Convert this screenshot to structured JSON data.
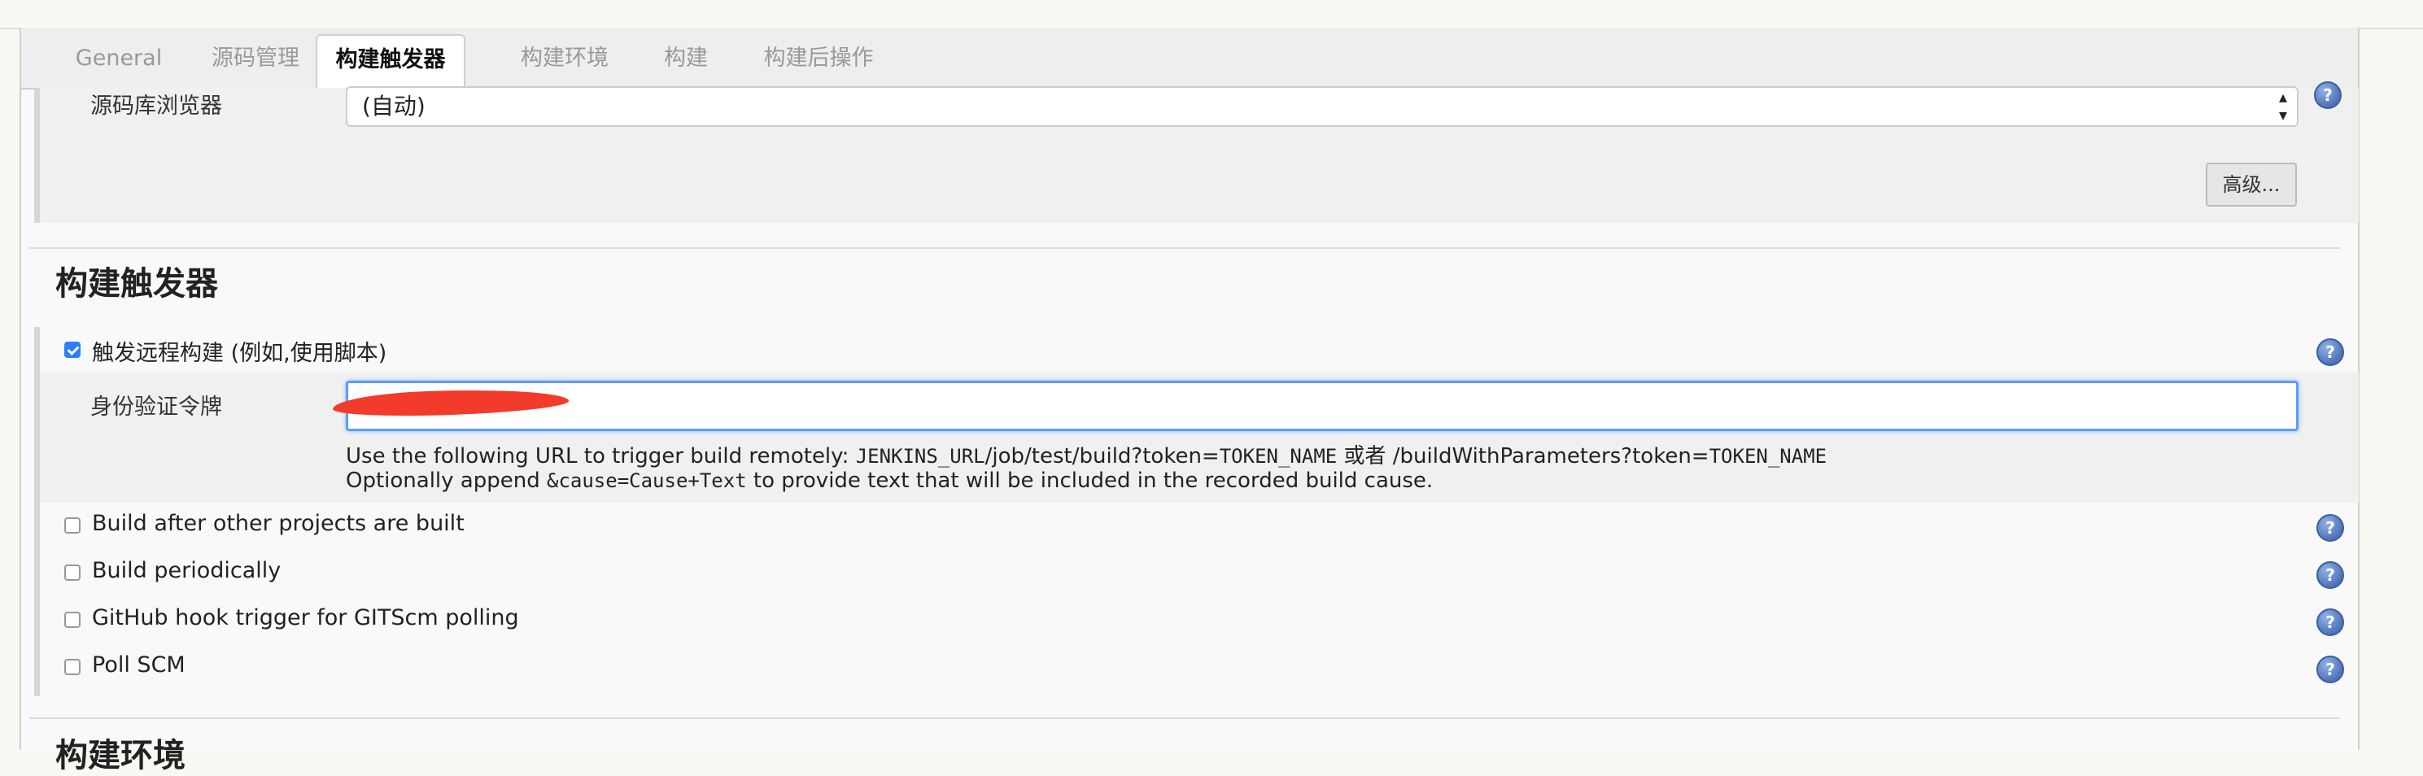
{
  "tabs": [
    {
      "label": "General"
    },
    {
      "label": "源码管理"
    },
    {
      "label": "构建触发器"
    },
    {
      "label": "构建环境"
    },
    {
      "label": "构建"
    },
    {
      "label": "构建后操作"
    }
  ],
  "scm": {
    "browser_label": "源码库浏览器",
    "browser_value": "(自动)",
    "advanced_button": "高级..."
  },
  "triggers": {
    "section_title": "构建触发器",
    "remote": {
      "label": "触发远程构建 (例如,使用脚本)",
      "checked": true,
      "token_label": "身份验证令牌",
      "token_value": "",
      "desc1_a": "Use the following URL to trigger build remotely: ",
      "desc1_b": "JENKINS_URL",
      "desc1_c": "/job/test/build?token=",
      "desc1_d": "TOKEN_NAME",
      "desc1_e": " 或者 /buildWithParameters?token=",
      "desc1_f": "TOKEN_NAME",
      "desc2_a": "Optionally append ",
      "desc2_b": "&cause=Cause+Text",
      "desc2_c": " to provide text that will be included in the recorded build cause."
    },
    "options": [
      {
        "label": "Build after other projects are built",
        "checked": false
      },
      {
        "label": "Build periodically",
        "checked": false
      },
      {
        "label": "GitHub hook trigger for GITScm polling",
        "checked": false
      },
      {
        "label": "Poll SCM",
        "checked": false
      }
    ]
  },
  "next_section_title": "构建环境",
  "help_icon_text": "?"
}
